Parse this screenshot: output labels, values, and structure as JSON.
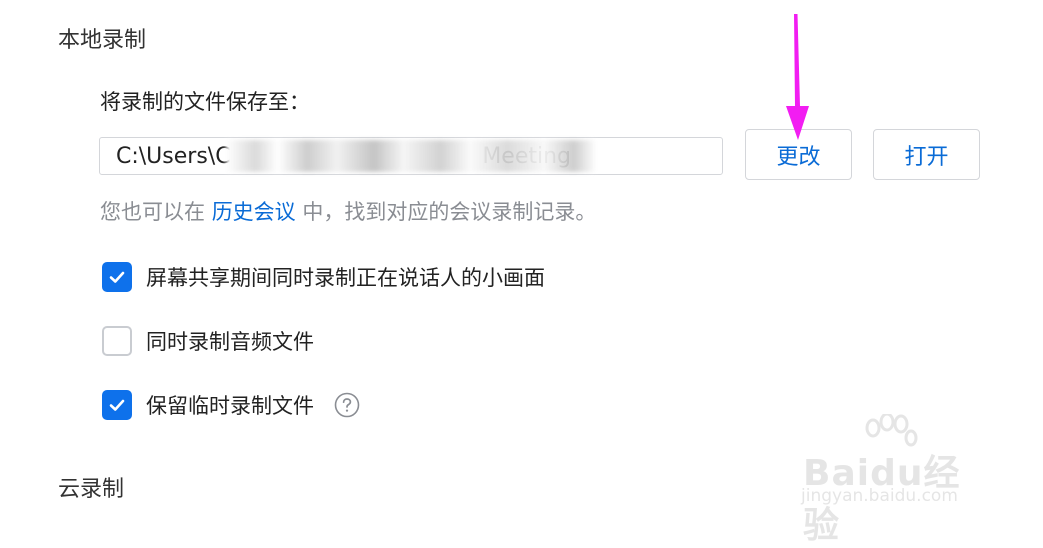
{
  "local_recording": {
    "section_title": "本地录制",
    "save_label": "将录制的文件保存至：",
    "path_value": "C:\\Users\\C                                    Meeting",
    "change_button": "更改",
    "open_button": "打开",
    "hint_prefix": "您也可以在 ",
    "hint_link": "历史会议",
    "hint_suffix": " 中，找到对应的会议录制记录。",
    "options": [
      {
        "label": "屏幕共享期间同时录制正在说话人的小画面",
        "checked": true
      },
      {
        "label": "同时录制音频文件",
        "checked": false
      },
      {
        "label": "保留临时录制文件",
        "checked": true
      }
    ]
  },
  "cloud_recording": {
    "section_title": "云录制"
  },
  "annotation": {
    "arrow_color": "#f21df2",
    "arrow_target": "change_button"
  },
  "watermark": {
    "brand": "Baidu经验",
    "url": "jingyan.baidu.com"
  },
  "colors": {
    "accent": "#0e71eb",
    "link": "#0a6bd6",
    "hint_text": "#8a8d93",
    "border": "#d4d6da"
  }
}
